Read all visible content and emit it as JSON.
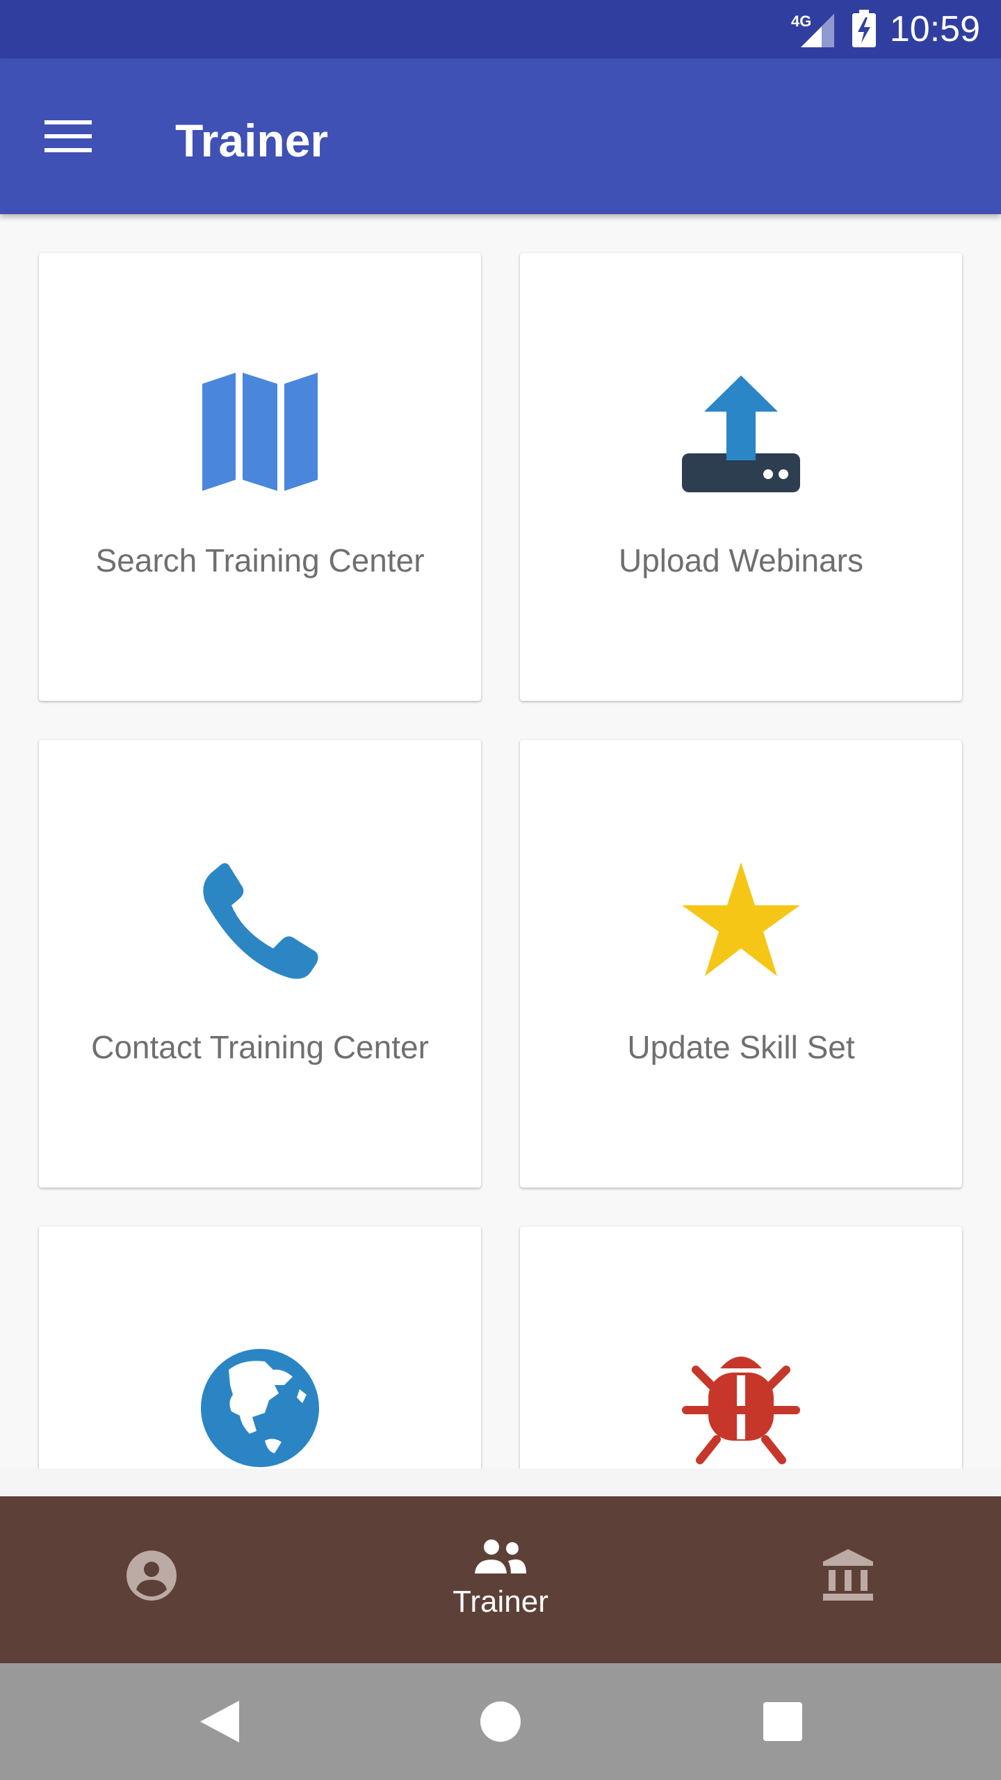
{
  "status_bar": {
    "network": "4G",
    "time": "10:59"
  },
  "app_bar": {
    "title": "Trainer",
    "menu_icon": "hamburger-menu-icon"
  },
  "tiles": [
    {
      "label": "Search Training Center",
      "icon": "map-icon",
      "color": "#4a86dc"
    },
    {
      "label": "Upload Webinars",
      "icon": "upload-icon",
      "color": "#2a86c6"
    },
    {
      "label": "Contact Training Center",
      "icon": "phone-icon",
      "color": "#2c86c4"
    },
    {
      "label": "Update Skill Set",
      "icon": "star-icon",
      "color": "#f6c616"
    },
    {
      "label": "",
      "icon": "globe-icon",
      "color": "#2b85c4"
    },
    {
      "label": "",
      "icon": "bug-icon",
      "color": "#c6372a"
    }
  ],
  "bottom_nav": {
    "items": [
      {
        "icon": "account-circle-icon",
        "label": ""
      },
      {
        "icon": "people-icon",
        "label": "Trainer"
      },
      {
        "icon": "institution-icon",
        "label": ""
      }
    ],
    "background": "#5d4037"
  },
  "colors": {
    "status_bar": "#303f9f",
    "app_bar": "#3f51b5"
  }
}
